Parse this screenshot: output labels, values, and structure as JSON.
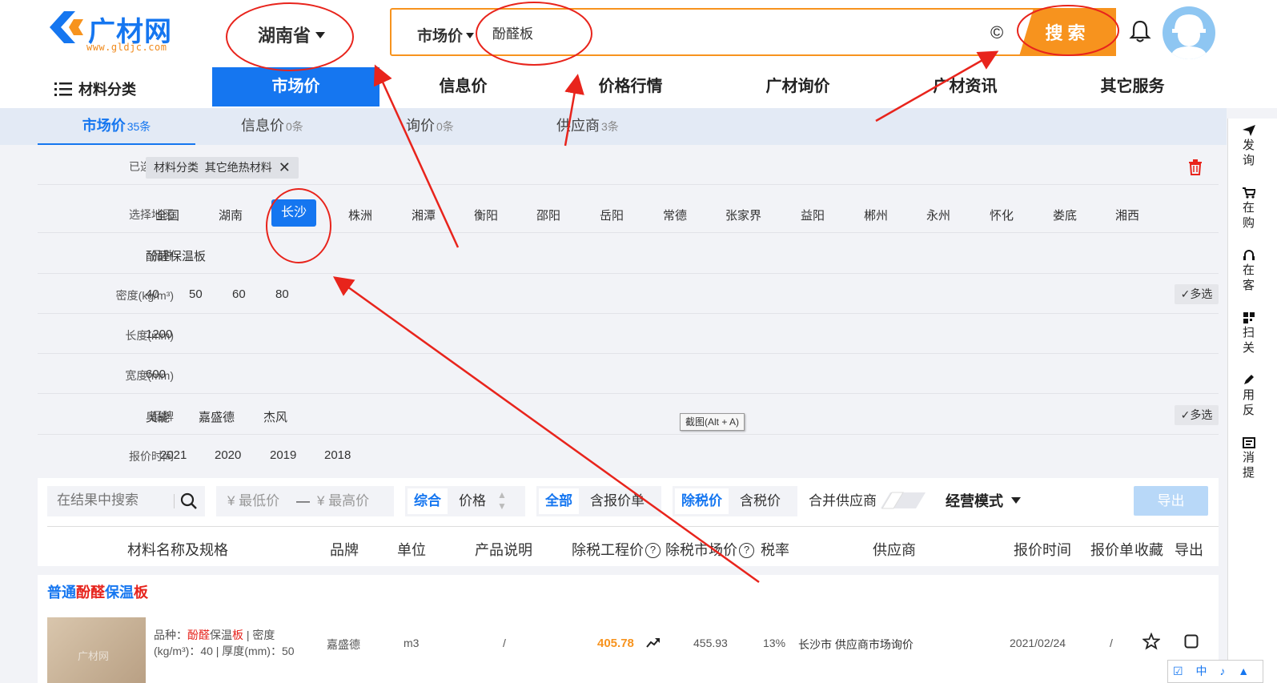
{
  "header": {
    "logo_text": "广材网",
    "logo_url": "www.gldjc.com",
    "province": "湖南省",
    "search_type": "市场价",
    "search_value": "酚醛板",
    "copy_symbol": "©",
    "search_button": "搜索"
  },
  "nav": {
    "category": "材料分类",
    "items": [
      "市场价",
      "信息价",
      "价格行情",
      "广材询价",
      "广材资讯",
      "其它服务"
    ]
  },
  "subtabs": [
    {
      "label": "市场价",
      "count": "35条"
    },
    {
      "label": "信息价",
      "count": "0条"
    },
    {
      "label": "询价",
      "count": "0条"
    },
    {
      "label": "供应商",
      "count": "3条"
    }
  ],
  "filters": {
    "selected": {
      "label": "已选条件",
      "chip_key": "材料分类",
      "chip_value": "其它绝热材料"
    },
    "region": {
      "label": "选择地区",
      "options": [
        "全国",
        "湖南",
        "长沙",
        "株洲",
        "湘潭",
        "衡阳",
        "邵阳",
        "岳阳",
        "常德",
        "张家界",
        "益阳",
        "郴州",
        "永州",
        "怀化",
        "娄底",
        "湘西"
      ],
      "active": "长沙"
    },
    "variety": {
      "label": "品种",
      "options": [
        "酚醛保温板"
      ]
    },
    "density": {
      "label": "密度(kg/m³)",
      "options": [
        "40",
        "50",
        "60",
        "80"
      ],
      "multi": "多选"
    },
    "length": {
      "label": "长度(mm)",
      "options": [
        "1200"
      ]
    },
    "width": {
      "label": "宽度(mm)",
      "options": [
        "600"
      ]
    },
    "brand": {
      "label": "品牌",
      "options": [
        "奥能",
        "嘉盛德",
        "杰风"
      ],
      "multi": "多选"
    },
    "quote_time": {
      "label": "报价时间",
      "options": [
        "2021",
        "2020",
        "2019",
        "2018"
      ]
    }
  },
  "tooltip": "截图(Alt + A)",
  "toolbar": {
    "search_placeholder": "在结果中搜索",
    "min_price": "¥ 最低价",
    "dash": "—",
    "max_price": "¥ 最高价",
    "sort": [
      "综合",
      "价格"
    ],
    "scope": [
      "全部",
      "含报价单"
    ],
    "tax": [
      "除税价",
      "含税价"
    ],
    "merge": "合并供应商",
    "mode": "经营模式",
    "export": "导出"
  },
  "table_headers": [
    "材料名称及规格",
    "品牌",
    "单位",
    "产品说明",
    "除税工程价",
    "除税市场价",
    "税率",
    "供应商",
    "报价时间",
    "报价单",
    "收藏",
    "导出"
  ],
  "product": {
    "title_parts": [
      {
        "text": "普通",
        "color": "blue"
      },
      {
        "text": "酚醛",
        "color": "red"
      },
      {
        "text": "保温",
        "color": "blue"
      },
      {
        "text": "板",
        "color": "red"
      }
    ],
    "image_watermark": "广材网",
    "desc_label": "品种：",
    "desc_red1": "酚醛",
    "desc_mid": "保温",
    "desc_red2": "板",
    "desc_rest": " | 密度(kg/m³)：40 | 厚度(mm)：50",
    "brand": "嘉盛德",
    "unit": "m3",
    "note": "/",
    "engineering_price": "405.78",
    "market_price": "455.93",
    "tax_rate": "13%",
    "supplier": "长沙市 供应商市场询价",
    "date": "2021/02/24",
    "quote_sheet": "/"
  },
  "sidebar": [
    {
      "line1": "发",
      "line2": "询"
    },
    {
      "line1": "在",
      "line2": "购"
    },
    {
      "line1": "在",
      "line2": "客"
    },
    {
      "line1": "扫",
      "line2": "关"
    },
    {
      "line1": "用",
      "line2": "反"
    },
    {
      "line1": "消",
      "line2": "提"
    }
  ],
  "bottom_tray": "☑ 中 ♪ ▲",
  "colors": {
    "brand_blue": "#1576f0",
    "accent_orange": "#f7931e",
    "annotation_red": "#e8241c"
  }
}
